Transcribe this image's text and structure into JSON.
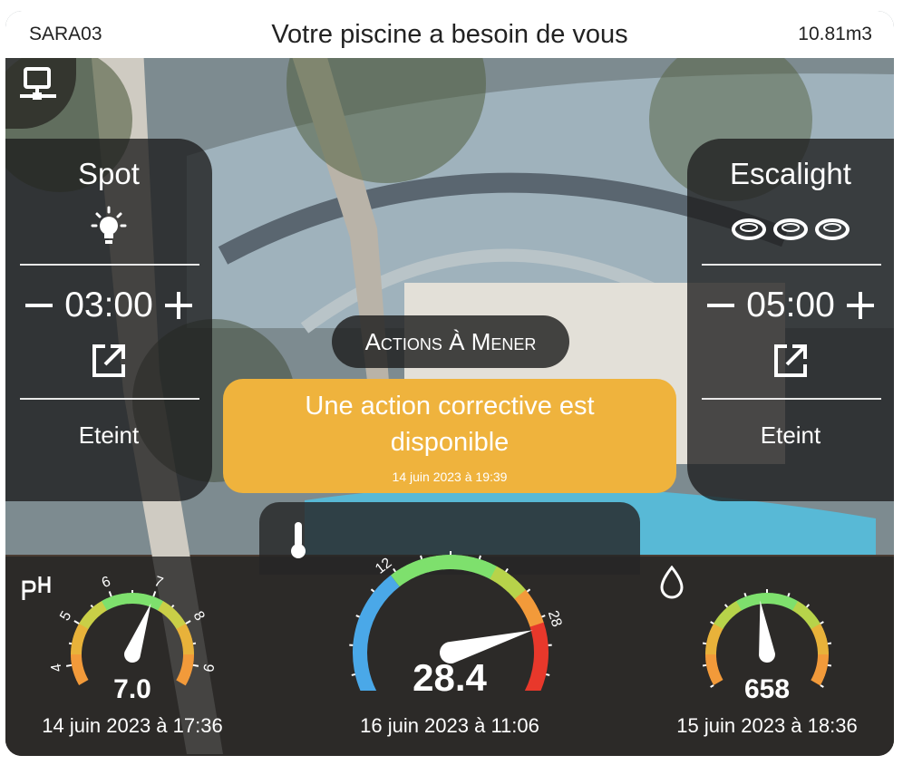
{
  "header": {
    "device": "SARA03",
    "title": "Votre piscine a besoin de vous",
    "volume": "10.81m3"
  },
  "icons": {
    "network": "network-icon",
    "bulb": "lightbulb-icon",
    "rings": "ring-lights-icon",
    "open": "open-in-new-icon",
    "thermometer": "thermometer-icon",
    "drop": "water-drop-icon",
    "ph": "ph-icon"
  },
  "spot": {
    "title": "Spot",
    "time": "03:00",
    "state": "Eteint"
  },
  "escalight": {
    "title": "Escalight",
    "time": "05:00",
    "state": "Eteint"
  },
  "actions": {
    "label": "Actions À Mener",
    "message": "Une action corrective est disponible",
    "date": "14 juin 2023 à 19:39"
  },
  "gauges": {
    "ph": {
      "label": "pH",
      "value": "7.0",
      "date": "14 juin 2023 à 17:36",
      "min": 3.5,
      "max": 9.5,
      "ticks": [
        "4",
        "5",
        "6",
        "7",
        "8",
        "9"
      ]
    },
    "temperature": {
      "value": "28.4",
      "date": "16 juin 2023 à 11:06",
      "min": 0,
      "max": 35,
      "ticks": [
        "0",
        "12",
        "28",
        "35"
      ]
    },
    "orp": {
      "value": "658",
      "date": "15 juin 2023 à 18:36",
      "fraction": 0.47
    }
  },
  "colors": {
    "alert": "#efb33d",
    "green": "#7ee06d",
    "blue": "#4aa8e8",
    "red": "#e8382b",
    "orange": "#f29a3a"
  }
}
